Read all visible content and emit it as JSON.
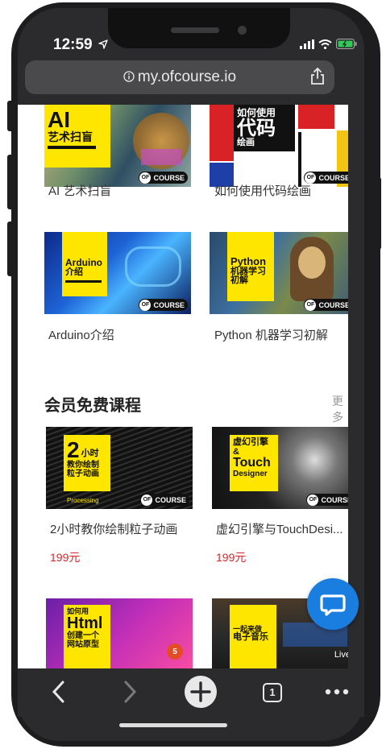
{
  "status": {
    "time": "12:59"
  },
  "browser": {
    "url": "my.ofcourse.io",
    "tab_count": "1"
  },
  "cards_top": [
    {
      "title": "AI 艺术扫盲",
      "badge_line1": "AI",
      "badge_line2": "艺术扫盲"
    },
    {
      "title": "如何使用代码绘画",
      "badge_line1": "如何使用",
      "badge_line2": "代码",
      "badge_line3": "绘画"
    },
    {
      "title": "Arduino介绍",
      "badge_line1": "Arduino",
      "badge_line2": "介绍"
    },
    {
      "title": "Python 机器学习初解",
      "badge_line1": "Python",
      "badge_line2": "机器学习",
      "badge_line3": "初解"
    }
  ],
  "section": {
    "title": "会员免费课程",
    "more": "更多"
  },
  "cards_member": [
    {
      "title": "2小时教你绘制粒子动画",
      "price": "199元",
      "badge_line1": "2",
      "badge_line2": "小时",
      "badge_line3": "教你绘制",
      "badge_line4": "粒子动画",
      "tag": "Processing"
    },
    {
      "title": "虚幻引擎与TouchDesi...",
      "price": "199元",
      "badge_line1": "虚幻引擎",
      "badge_line2": "&",
      "badge_line3": "Touch",
      "badge_line4": "Designer"
    }
  ],
  "cards_bottom": [
    {
      "badge_line1": "如何用",
      "badge_line2": "Html",
      "badge_line3": "创建一个",
      "badge_line4": "网站原型"
    },
    {
      "badge_line1": "一起来做",
      "badge_line2": "电子音乐",
      "tag": "Live"
    }
  ],
  "brand": {
    "logo_text": "COURSE",
    "logo_short": "OF"
  },
  "colors": {
    "accent_yellow": "#ffe600",
    "price_red": "#d8262b",
    "chat_blue": "#1a7de0",
    "chrome_dark": "#2b2b2d"
  },
  "icons": [
    "location-arrow-icon",
    "signal-icon",
    "wifi-icon",
    "battery-icon",
    "info-icon",
    "share-icon",
    "back-icon",
    "forward-icon",
    "new-tab-icon",
    "tabs-icon",
    "more-icon",
    "chat-icon"
  ]
}
